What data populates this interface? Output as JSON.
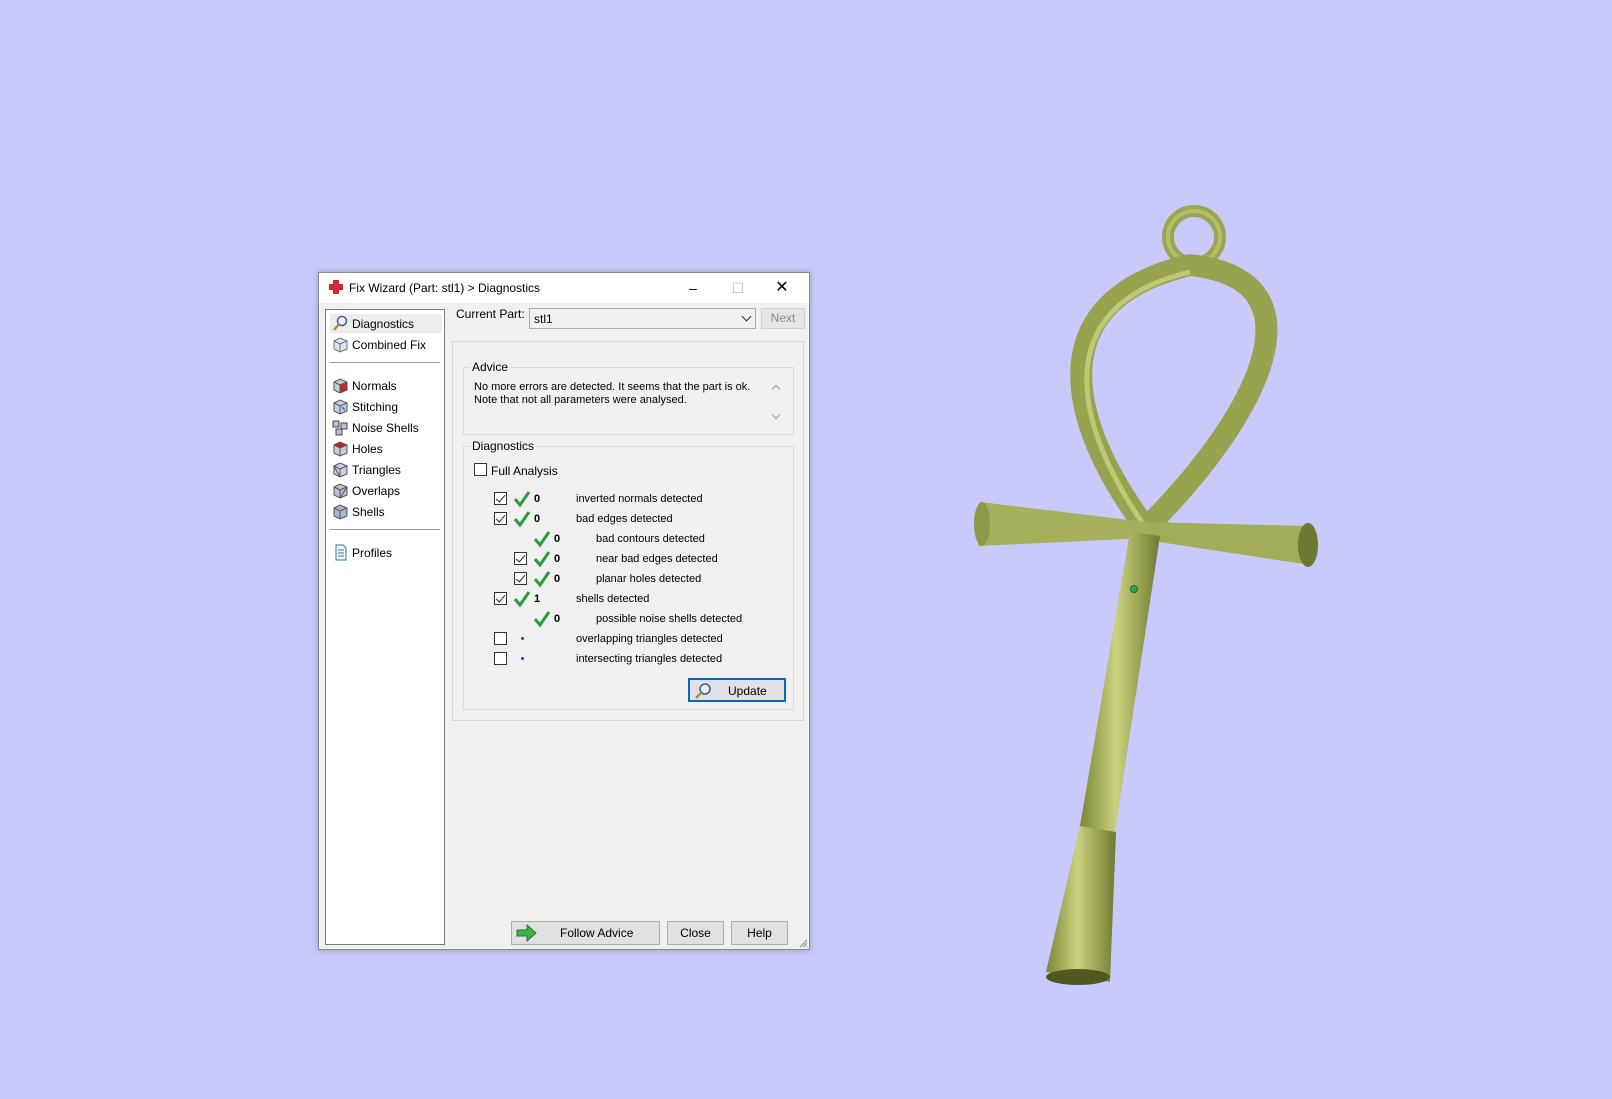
{
  "window": {
    "title": "Fix Wizard (Part: stl1) > Diagnostics",
    "controls": {
      "minimize": "–",
      "maximize": "☐",
      "close": "✕"
    }
  },
  "nav": {
    "items": [
      {
        "label": "Diagnostics",
        "icon": "magnifier-icon",
        "selected": true
      },
      {
        "label": "Combined Fix",
        "icon": "cube-icon"
      },
      {
        "label": "Normals",
        "icon": "red-cube-icon"
      },
      {
        "label": "Stitching",
        "icon": "stitching-cube-icon"
      },
      {
        "label": "Noise Shells",
        "icon": "noise-shells-icon"
      },
      {
        "label": "Holes",
        "icon": "holes-cube-icon"
      },
      {
        "label": "Triangles",
        "icon": "triangles-cube-icon"
      },
      {
        "label": "Overlaps",
        "icon": "overlaps-cube-icon"
      },
      {
        "label": "Shells",
        "icon": "shells-cube-icon"
      },
      {
        "label": "Profiles",
        "icon": "document-icon"
      }
    ]
  },
  "current_part": {
    "label": "Current Part:",
    "value": "stl1",
    "next_label": "Next"
  },
  "advice": {
    "title": "Advice",
    "text": "No more errors are detected. It seems that the part is ok.\nNote that not all parameters were analysed."
  },
  "diagnostics": {
    "title": "Diagnostics",
    "full_analysis": {
      "label": "Full Analysis",
      "checked": false
    },
    "rows": [
      {
        "checkbox": true,
        "checked": true,
        "status": "ok",
        "count": "0",
        "label": "inverted normals detected",
        "indent": 0
      },
      {
        "checkbox": true,
        "checked": true,
        "status": "ok",
        "count": "0",
        "label": "bad edges detected",
        "indent": 0
      },
      {
        "checkbox": false,
        "checked": false,
        "status": "ok",
        "count": "0",
        "label": "bad contours detected",
        "indent": 1
      },
      {
        "checkbox": true,
        "checked": true,
        "status": "ok",
        "count": "0",
        "label": "near bad edges detected",
        "indent": 1
      },
      {
        "checkbox": true,
        "checked": true,
        "status": "ok",
        "count": "0",
        "label": "planar holes detected",
        "indent": 1
      },
      {
        "checkbox": true,
        "checked": true,
        "status": "ok",
        "count": "1",
        "label": "shells detected",
        "indent": 0
      },
      {
        "checkbox": false,
        "checked": false,
        "status": "ok",
        "count": "0",
        "label": "possible noise shells detected",
        "indent": 1
      },
      {
        "checkbox": true,
        "checked": false,
        "status": "pending",
        "count": "",
        "label": "overlapping triangles detected",
        "indent": 0
      },
      {
        "checkbox": true,
        "checked": false,
        "status": "pending",
        "count": "",
        "label": "intersecting triangles detected",
        "indent": 0
      }
    ],
    "update_label": "Update"
  },
  "buttons": {
    "follow_advice": "Follow Advice",
    "close": "Close",
    "help": "Help"
  },
  "colors": {
    "background": "#c9c9fb",
    "model": "#a4b05c",
    "check_green": "#2e9a3c",
    "focus_blue": "#0a64c8"
  }
}
